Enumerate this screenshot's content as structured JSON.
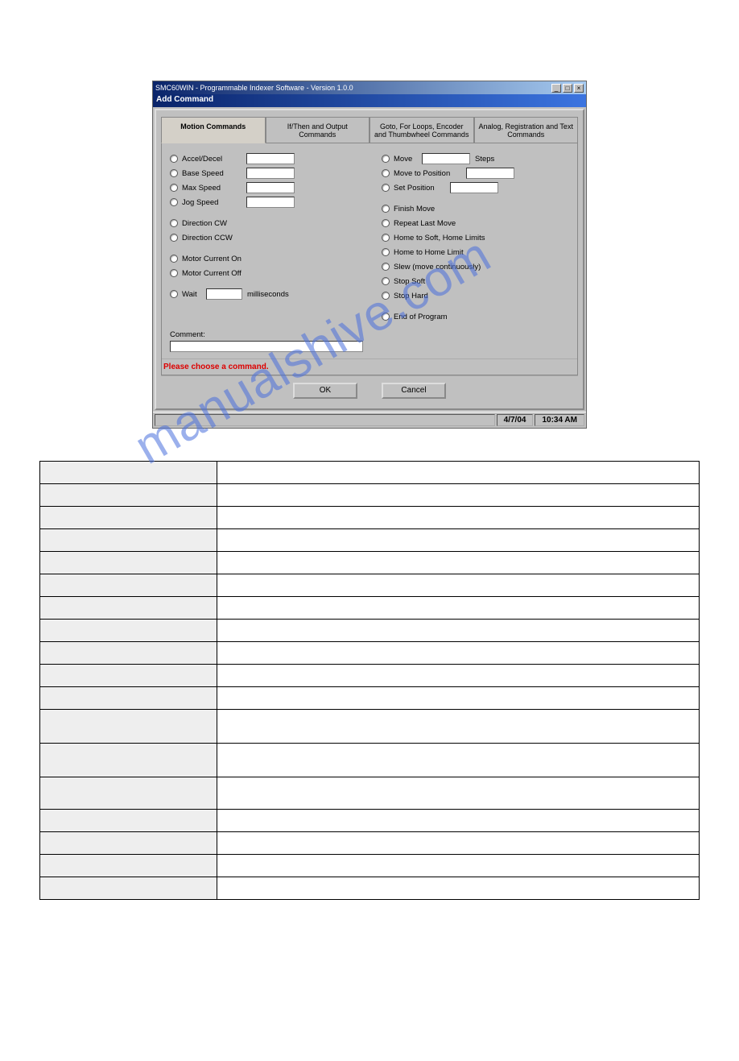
{
  "app_window": {
    "title": "SMC60WIN - Programmable Indexer Software - Version 1.0.0",
    "subtitle": "Add Command"
  },
  "tabs": {
    "t0": "Motion Commands",
    "t1": "If/Then and Output Commands",
    "t2": "Goto, For Loops, Encoder and Thumbwheel Commands",
    "t3": "Analog, Registration and Text Commands"
  },
  "left_options": {
    "accel": "Accel/Decel",
    "base": "Base Speed",
    "max": "Max Speed",
    "jog": "Jog Speed",
    "dir_cw": "Direction CW",
    "dir_ccw": "Direction CCW",
    "motor_on": "Motor Current On",
    "motor_off": "Motor Current Off",
    "wait": "Wait",
    "wait_unit": "milliseconds"
  },
  "right_options": {
    "move": "Move",
    "move_unit": "Steps",
    "move_pos": "Move to Position",
    "set_pos": "Set Position",
    "finish": "Finish Move",
    "repeat": "Repeat Last Move",
    "home_soft": "Home to Soft, Home Limits",
    "home_home": "Home to Home Limit",
    "slew": "Slew (move continuously)",
    "stop_soft": "Stop Soft",
    "stop_hard": "Stop Hard",
    "end": "End of Program"
  },
  "comment": {
    "label": "Comment:"
  },
  "error": "Please choose a command.",
  "buttons": {
    "ok": "OK",
    "cancel": "Cancel"
  },
  "statusbar": {
    "date": "4/7/04",
    "time": "10:34 AM"
  },
  "watermark": "manualshive.com"
}
